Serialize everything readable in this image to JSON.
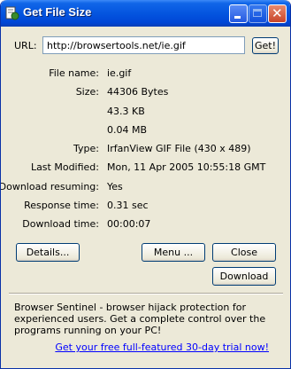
{
  "window": {
    "title": "Get File Size"
  },
  "url": {
    "label": "URL:",
    "value": "http://browsertools.net/ie.gif",
    "get_button": "Get!"
  },
  "fields": [
    {
      "label": "File name:",
      "value": "ie.gif"
    },
    {
      "label": "Size:",
      "value": "44306 Bytes"
    },
    {
      "label": "",
      "value": "43.3 KB"
    },
    {
      "label": "",
      "value": "0.04 MB"
    },
    {
      "label": "Type:",
      "value": "IrfanView GIF File (430 x 489)"
    },
    {
      "label": "Last Modified:",
      "value": "Mon, 11 Apr 2005 10:55:18 GMT"
    },
    {
      "label": "Download resuming:",
      "value": "Yes"
    },
    {
      "label": "Response time:",
      "value": "0.31 sec"
    },
    {
      "label": "Download time:",
      "value": "00:00:07"
    }
  ],
  "buttons": {
    "details": "Details...",
    "menu": "Menu ...",
    "close": "Close",
    "download": "Download"
  },
  "promo": {
    "text": "Browser Sentinel - browser hijack protection for experienced users. Get a complete control over the programs running on your PC!",
    "link": "Get your free full-featured 30-day trial now!"
  }
}
